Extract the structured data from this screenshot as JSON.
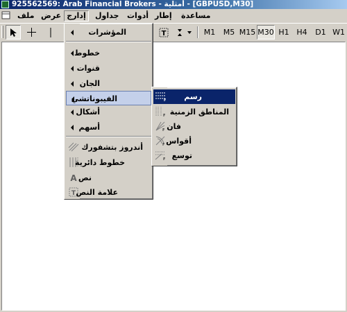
{
  "window": {
    "title": "925562569: Arab Financial Brokers - أمثلية - [GBPUSD,M30]"
  },
  "menubar": {
    "items": [
      {
        "key": "file",
        "label": "ملف"
      },
      {
        "key": "view",
        "label": "عرض"
      },
      {
        "key": "insert",
        "label": "إدارج"
      },
      {
        "key": "charts",
        "label": "جداول"
      },
      {
        "key": "tools",
        "label": "أدوات"
      },
      {
        "key": "window",
        "label": "إطار"
      },
      {
        "key": "help",
        "label": "مساعدة"
      }
    ]
  },
  "toolbar": {
    "periods": [
      "M1",
      "M5",
      "M15",
      "M30",
      "H1",
      "H4",
      "D1",
      "W1"
    ],
    "active_period": "M30",
    "text_tool_label": "T"
  },
  "insert_menu": {
    "items": [
      {
        "label": "المؤشرات",
        "submenu": true
      },
      {
        "label": "خطوط",
        "submenu": true
      },
      {
        "label": "قنوات",
        "submenu": true
      },
      {
        "label": "الجان",
        "submenu": true
      },
      {
        "label": "الفيبوناتشي",
        "submenu": true
      },
      {
        "label": "أشكال",
        "submenu": true
      },
      {
        "label": "أسهم",
        "submenu": true
      },
      {
        "label": "أندروز بتشفورك",
        "icon": "andrews-pitchfork-icon"
      },
      {
        "label": "خطوط دائرية",
        "icon": "cycle-lines-icon"
      },
      {
        "label": "نص",
        "icon": "text-icon"
      },
      {
        "label": "علامة النص",
        "icon": "text-label-icon"
      }
    ]
  },
  "fibonacci_submenu": {
    "items": [
      {
        "label": "رسم",
        "icon": "fibo-retracement-icon"
      },
      {
        "label": "المناطق الزمنية",
        "icon": "fibo-timezones-icon"
      },
      {
        "label": "فان",
        "icon": "fibo-fan-icon"
      },
      {
        "label": "أقواس",
        "icon": "fibo-arcs-icon"
      },
      {
        "label": "توسع",
        "icon": "fibo-expansion-icon"
      }
    ]
  }
}
